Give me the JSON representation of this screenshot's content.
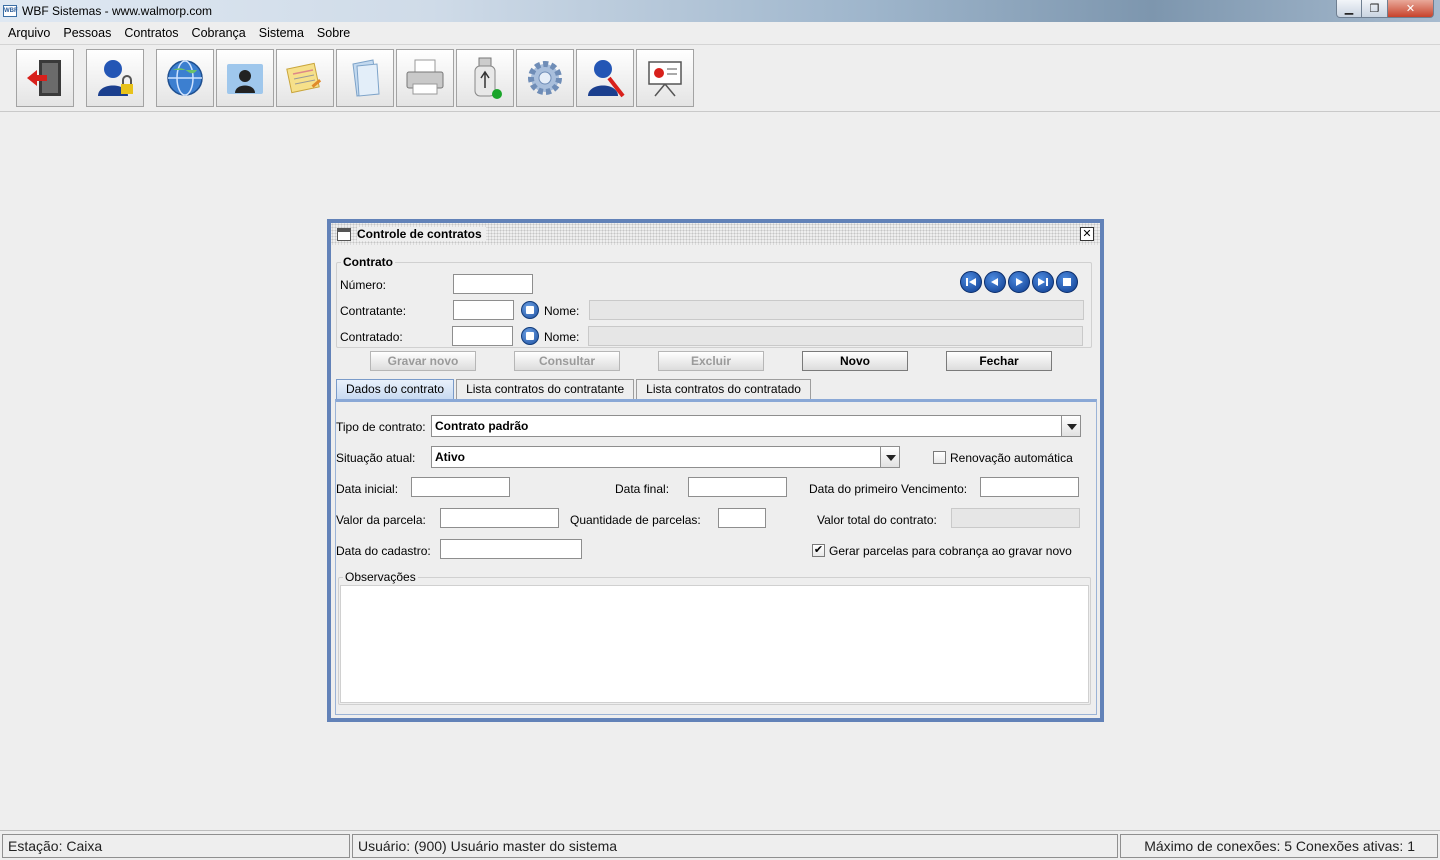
{
  "window": {
    "title": "WBF Sistemas - www.walmorp.com",
    "app_icon_text": "WBF"
  },
  "menu": [
    {
      "label": "Arquivo"
    },
    {
      "label": "Pessoas"
    },
    {
      "label": "Contratos"
    },
    {
      "label": "Cobrança"
    },
    {
      "label": "Sistema"
    },
    {
      "label": "Sobre"
    }
  ],
  "toolbar": {
    "icons": [
      "exit-door-icon",
      "user-lock-icon",
      "globe-icon",
      "contact-folder-icon",
      "notes-icon",
      "folder-icon",
      "printer-icon",
      "usb-drive-icon",
      "gear-icon",
      "user-tools-icon",
      "presentation-board-icon"
    ]
  },
  "frame": {
    "title": "Controle de contratos",
    "group_contrato": "Contrato",
    "numero_label": "Número:",
    "numero_value": "",
    "contratante_label": "Contratante:",
    "contratante_value": "",
    "contratado_label": "Contratado:",
    "contratado_value": "",
    "nome_label": "Nome:",
    "nome_contratante_value": "",
    "nome_contratado_value": "",
    "buttons": {
      "gravar_novo": "Gravar novo",
      "consultar": "Consultar",
      "excluir": "Excluir",
      "novo": "Novo",
      "fechar": "Fechar"
    },
    "tabs": [
      "Dados do contrato",
      "Lista contratos do contratante",
      "Lista contratos do contratado"
    ],
    "active_tab": 0,
    "form": {
      "tipo_label": "Tipo de contrato:",
      "tipo_value": "Contrato padrão",
      "situacao_label": "Situação atual:",
      "situacao_value": "Ativo",
      "renovacao_label": "Renovação automática",
      "renovacao_checked": false,
      "data_inicial_label": "Data inicial:",
      "data_final_label": "Data final:",
      "primeiro_venc_label": "Data do primeiro Vencimento:",
      "valor_parcela_label": "Valor da parcela:",
      "qtd_parcelas_label": "Quantidade de parcelas:",
      "valor_total_label": "Valor total do contrato:",
      "data_cadastro_label": "Data do cadastro:",
      "gerar_label": "Gerar parcelas para cobrança ao gravar novo",
      "gerar_checked": true,
      "observacoes_label": "Observações"
    }
  },
  "status": {
    "estacao": "Estação: Caixa",
    "usuario": "Usuário: (900) Usuário master do sistema",
    "conexoes": "Máximo de conexões: 5 Conexões ativas: 1"
  },
  "colors": {
    "frame_border": "#6282b8",
    "nav_blue": "#1d4f9f",
    "close_red": "#c7422b"
  }
}
